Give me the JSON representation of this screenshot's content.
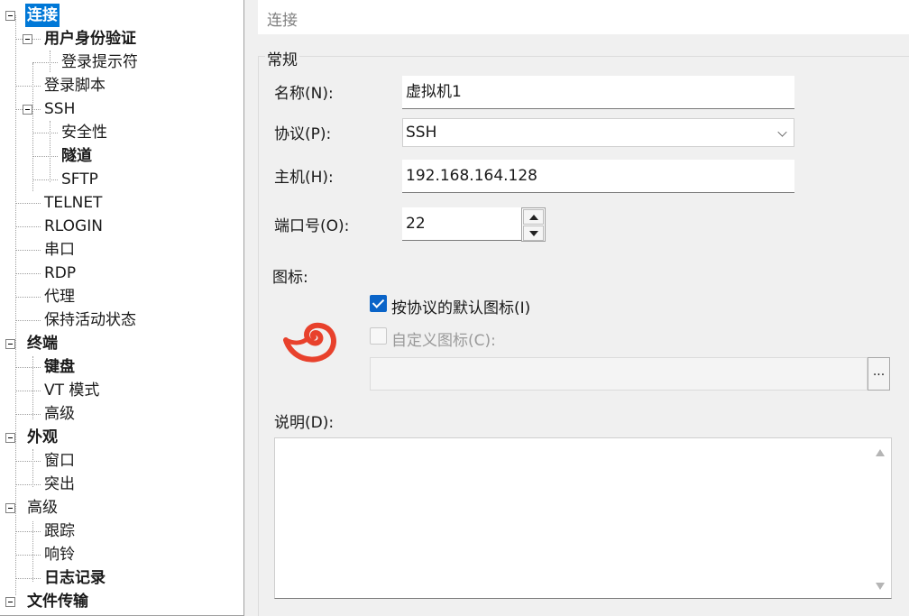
{
  "tree": {
    "items": [
      {
        "label": "连接",
        "level": 0,
        "bold": true,
        "selected": true,
        "expander": true
      },
      {
        "label": "用户身份验证",
        "level": 1,
        "bold": true,
        "expander": true
      },
      {
        "label": "登录提示符",
        "level": 2
      },
      {
        "label": "登录脚本",
        "level": 1
      },
      {
        "label": "SSH",
        "level": 1,
        "expander": true
      },
      {
        "label": "安全性",
        "level": 2
      },
      {
        "label": "隧道",
        "level": 2,
        "bold": true
      },
      {
        "label": "SFTP",
        "level": 2
      },
      {
        "label": "TELNET",
        "level": 1
      },
      {
        "label": "RLOGIN",
        "level": 1
      },
      {
        "label": "串口",
        "level": 1
      },
      {
        "label": "RDP",
        "level": 1
      },
      {
        "label": "代理",
        "level": 1
      },
      {
        "label": "保持活动状态",
        "level": 1
      },
      {
        "label": "终端",
        "level": 0,
        "bold": true,
        "expander": true
      },
      {
        "label": "键盘",
        "level": 1,
        "bold": true
      },
      {
        "label": "VT 模式",
        "level": 1
      },
      {
        "label": "高级",
        "level": 1
      },
      {
        "label": "外观",
        "level": 0,
        "bold": true,
        "expander": true
      },
      {
        "label": "窗口",
        "level": 1
      },
      {
        "label": "突出",
        "level": 1
      },
      {
        "label": "高级",
        "level": 0,
        "expander": true
      },
      {
        "label": "跟踪",
        "level": 1
      },
      {
        "label": "响铃",
        "level": 1
      },
      {
        "label": "日志记录",
        "level": 1,
        "bold": true
      },
      {
        "label": "文件传输",
        "level": 0,
        "bold": true,
        "expander": true
      }
    ]
  },
  "header": {
    "title": "连接"
  },
  "general": {
    "group_title": "常规",
    "name_label": "名称(N):",
    "name_value": "虚拟机1",
    "protocol_label": "协议(P):",
    "protocol_value": "SSH",
    "host_label": "主机(H):",
    "host_value": "192.168.164.128",
    "port_label": "端口号(O):",
    "port_value": "22",
    "icon_label": "图标:",
    "default_icon_label": "按协议的默认图标(I)",
    "default_icon_checked": true,
    "custom_icon_label": "自定义图标(C):",
    "custom_icon_checked": false,
    "custom_icon_path": "",
    "browse_label": "...",
    "description_label": "说明(D):",
    "description_value": ""
  },
  "colors": {
    "accent": "#0078d7",
    "icon_red": "#e8412c"
  }
}
